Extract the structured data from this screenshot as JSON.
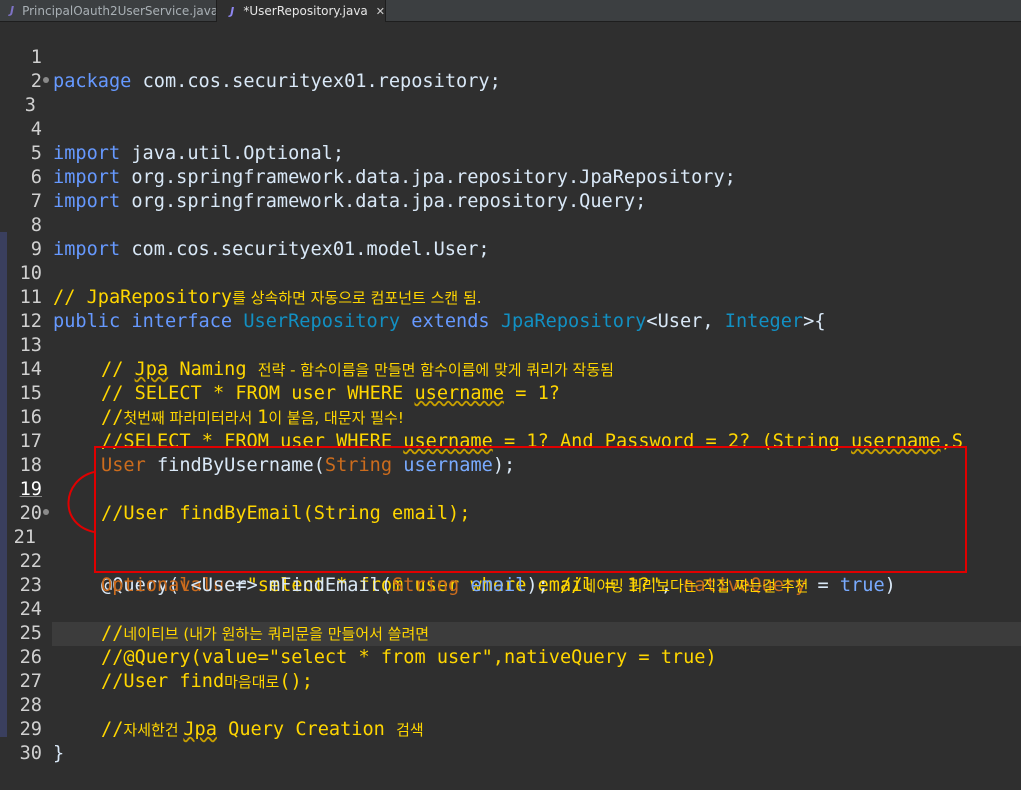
{
  "tabs": [
    {
      "label": "PrincipalOauth2UserService.java",
      "icon": "java-file-icon"
    },
    {
      "label": "*UserRepository.java",
      "icon": "java-class-icon",
      "close": "✕"
    }
  ],
  "lines": [
    {
      "n": "1"
    },
    {
      "n": "2"
    },
    {
      "n": "3"
    },
    {
      "n": "4"
    },
    {
      "n": "5"
    },
    {
      "n": "6"
    },
    {
      "n": "7"
    },
    {
      "n": "8"
    },
    {
      "n": "9"
    },
    {
      "n": "10"
    },
    {
      "n": "11"
    },
    {
      "n": "12"
    },
    {
      "n": "13"
    },
    {
      "n": "14"
    },
    {
      "n": "15"
    },
    {
      "n": "16"
    },
    {
      "n": "17"
    },
    {
      "n": "18"
    },
    {
      "n": "19"
    },
    {
      "n": "20"
    },
    {
      "n": "21"
    },
    {
      "n": "22"
    },
    {
      "n": "23"
    },
    {
      "n": "24"
    },
    {
      "n": "25"
    },
    {
      "n": "26"
    },
    {
      "n": "27"
    },
    {
      "n": "28"
    },
    {
      "n": "29"
    },
    {
      "n": "30"
    }
  ],
  "code": {
    "l1_kw": "package",
    "l1_rest": " com.cos.securityex01.repository;",
    "l3_kw": "import",
    "l3_rest": " java.util.Optional;",
    "l5_kw": "import",
    "l5_rest": " org.springframework.data.jpa.repository.JpaRepository;",
    "l6_kw": "import",
    "l6_rest": " org.springframework.data.jpa.repository.Query;",
    "l8_kw": "import",
    "l8_rest": " com.cos.securityex01.model.User;",
    "l10_a": "// JpaRepository",
    "l10_b": "를 상속하면 자동으로 컴포넌트 스캔 됨.",
    "l11_a": "public",
    "l11_b": " ",
    "l11_c": "interface",
    "l11_d": " ",
    "l11_e": "UserRepository",
    "l11_f": " ",
    "l11_g": "extends",
    "l11_h": " ",
    "l11_i": "JpaRepository",
    "l11_j": "<User, ",
    "l11_k": "Integer",
    "l11_l": ">{",
    "l13_a": "// ",
    "l13_b": "Jpa",
    "l13_c": " Naming ",
    "l13_d": "전략 - 함수이름을 만들면 함수이름에 맞게 쿼리가 작동됨",
    "l14_a": "// SELECT * FROM user WHERE ",
    "l14_b": "username",
    "l14_c": " = 1?",
    "l15_a": "//",
    "l15_b": "첫번째 파라미터라서 ",
    "l15_c": "1",
    "l15_d": "이 붙음, 대문자 필수!",
    "l16_a": "//SELECT * FROM user WHERE ",
    "l16_b": "username",
    "l16_c": " = 1? And Password = 2? (String ",
    "l16_d": "username",
    "l16_e": ",S",
    "l17_a": "User",
    "l17_b": " findByUsername(",
    "l17_c": "String",
    "l17_d": " ",
    "l17_e": "username",
    "l17_f": ");",
    "l19_a": "//User findByEmail(String email);",
    "l21_a": "@Query",
    "l21_b": "(",
    "l21_c": "value",
    "l21_d": "=",
    "l21_e": "\"select * from user where email = 1?\"",
    "l21_f": ", ",
    "l21_g": "nativeQuery",
    "l21_h": " = ",
    "l21_i": "true",
    "l21_j": ")",
    "l22_a": "Optional",
    "l22_b": "<User> mFindEmail(",
    "l22_c": "String",
    "l22_d": " ",
    "l22_e": "email",
    "l22_f": "); ",
    "l22_g": "//",
    "l22_h": "네이밍 쿼리보다는 직접 짜는걸 추천",
    "l24_a": "//",
    "l24_b": "네이티브 (내가 원하는 쿼리문을 만들어서 쓸려면",
    "l25_a": "//@Query(value=\"select * from user\",nativeQuery = true)",
    "l26_a": "//User find",
    "l26_b": "마음대로",
    "l26_c": "();",
    "l28_a": "//",
    "l28_b": "자세한건 ",
    "l28_c": "Jpa",
    "l28_d": " Query Creation ",
    "l28_e": "검색",
    "l29_a": "}"
  },
  "colors": {
    "highlight_box": "#e00000",
    "comment": "#ffd600",
    "keyword": "#cc6c1d",
    "string": "#17c6a3",
    "background": "#2f2f2f"
  }
}
